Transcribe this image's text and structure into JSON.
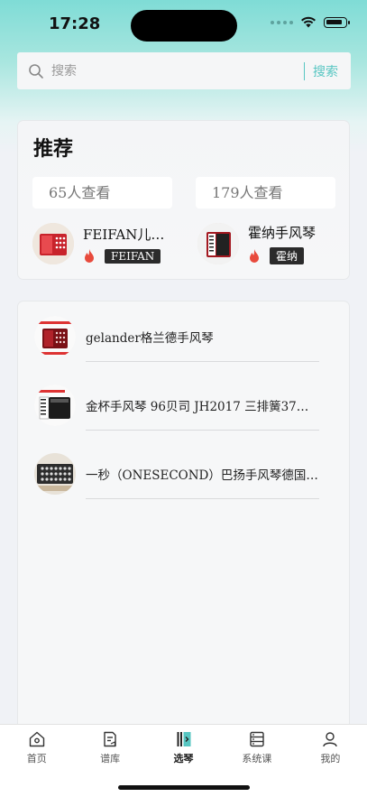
{
  "status": {
    "time": "17:28"
  },
  "search": {
    "placeholder": "搜索",
    "button": "搜索"
  },
  "recommend": {
    "title": "推荐",
    "items": [
      {
        "views": "65人查看",
        "name": "FEIFAN儿童…",
        "tag": "FEIFAN"
      },
      {
        "views": "179人查看",
        "name": "霍纳手风琴",
        "tag": "霍纳"
      }
    ]
  },
  "list": {
    "items": [
      {
        "title": "gelander格兰德手风琴"
      },
      {
        "title": "金杯手风琴 96贝司 JH2017 三排簧37键 …"
      },
      {
        "title": "一秒（ONESECOND）巴扬手风琴德国…"
      }
    ]
  },
  "tabs": [
    {
      "label": "首页",
      "icon": "home-icon"
    },
    {
      "label": "谱库",
      "icon": "score-icon"
    },
    {
      "label": "选琴",
      "icon": "piano-icon",
      "active": true
    },
    {
      "label": "系统课",
      "icon": "course-icon"
    },
    {
      "label": "我的",
      "icon": "user-icon"
    }
  ],
  "colors": {
    "accent": "#57c6c2",
    "tag_bg": "#2b2b2b",
    "flame": "#e84a3c"
  }
}
